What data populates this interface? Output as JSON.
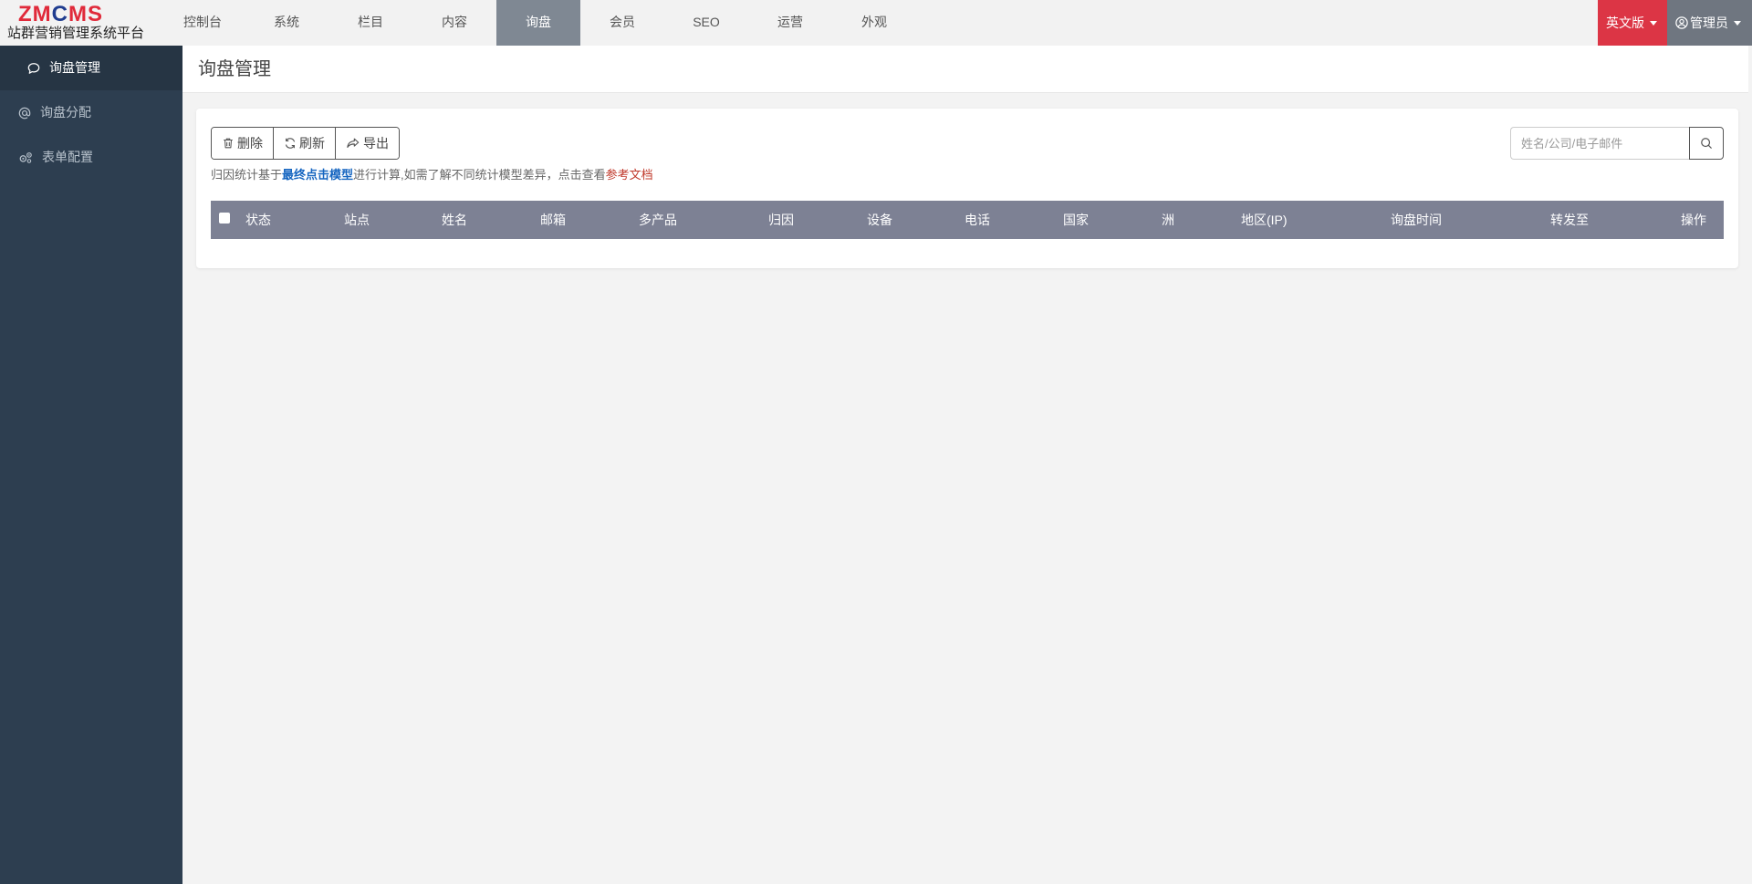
{
  "brand": {
    "logo_letters": [
      {
        "ch": "Z",
        "color": "#e02a3a"
      },
      {
        "ch": "M",
        "color": "#e02a3a"
      },
      {
        "ch": "C",
        "color": "#1f3c8f"
      },
      {
        "ch": "M",
        "color": "#e02a3a"
      },
      {
        "ch": "S",
        "color": "#e02a3a"
      }
    ],
    "subtitle": "站群营销管理系统平台"
  },
  "topnav": {
    "items": [
      {
        "label": "控制台",
        "active": false
      },
      {
        "label": "系统",
        "active": false
      },
      {
        "label": "栏目",
        "active": false
      },
      {
        "label": "内容",
        "active": false
      },
      {
        "label": "询盘",
        "active": true
      },
      {
        "label": "会员",
        "active": false
      },
      {
        "label": "SEO",
        "active": false
      },
      {
        "label": "运营",
        "active": false
      },
      {
        "label": "外观",
        "active": false
      }
    ],
    "language": "英文版",
    "user": "管理员"
  },
  "sidebar": {
    "items": [
      {
        "label": "询盘管理",
        "icon": "chat-bubble-icon",
        "active": true
      },
      {
        "label": "询盘分配",
        "icon": "at-sign-icon",
        "active": false
      },
      {
        "label": "表单配置",
        "icon": "gears-icon",
        "active": false
      }
    ]
  },
  "page": {
    "title": "询盘管理"
  },
  "toolbar": {
    "delete_label": "删除",
    "refresh_label": "刷新",
    "export_label": "导出"
  },
  "note": {
    "prefix": "归因统计基于",
    "model_link": "最终点击模型",
    "middle": "进行计算,如需了解不同统计模型差异，点击查看",
    "doc_link": "参考文档"
  },
  "search": {
    "placeholder": "姓名/公司/电子邮件",
    "value": ""
  },
  "table": {
    "columns": [
      "状态",
      "站点",
      "姓名",
      "邮箱",
      "多产品",
      "归因",
      "设备",
      "电话",
      "国家",
      "洲",
      "地区(IP)",
      "询盘时间",
      "转发至",
      "操作"
    ],
    "rows": []
  },
  "colors": {
    "accent_red": "#dc3545",
    "nav_active": "#7f8893",
    "sidebar_bg": "#2d3e50",
    "table_header": "#7d8194"
  }
}
